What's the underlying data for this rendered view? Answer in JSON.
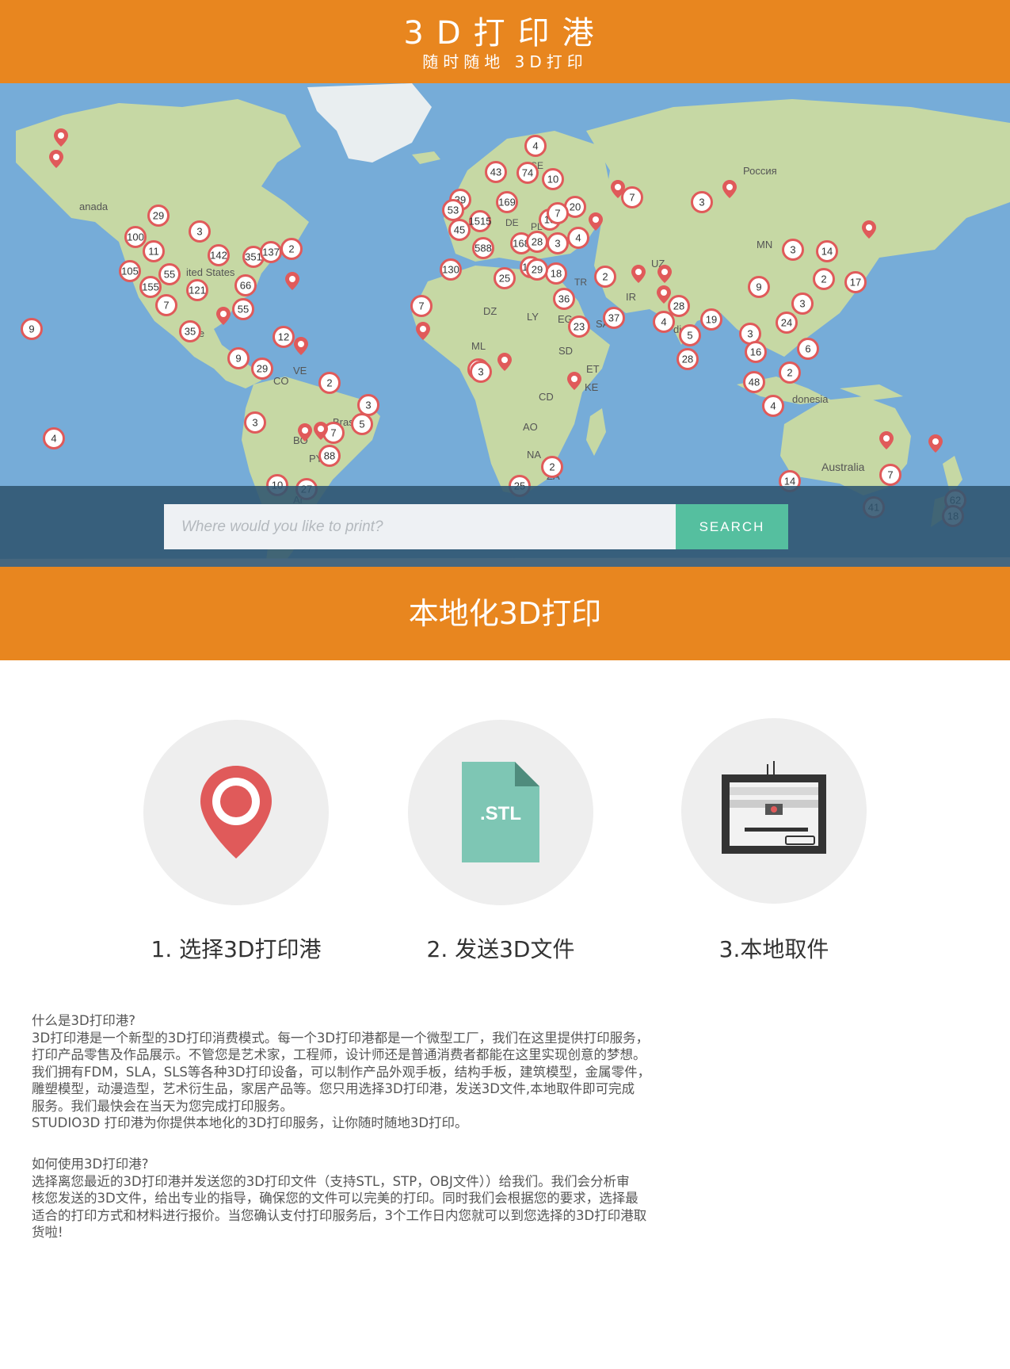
{
  "header": {
    "title": "3D打印港",
    "subtitle": "随时随地 3D打印"
  },
  "map": {
    "ocean_color": "#76acd8",
    "land_color": "#c6d8a4",
    "places": [
      "Россия",
      "anada",
      "ited States",
      "MN",
      "Australia",
      "donesia",
      "Brasil",
      "DZ",
      "LY",
      "EG",
      "ML",
      "SD",
      "CD",
      "AO",
      "NA",
      "ZA",
      "KE",
      "ET",
      "SA",
      "IR",
      "UZ",
      "VE",
      "CO",
      "BO",
      "PY",
      "Ar",
      "Me",
      "dia",
      "DE",
      "PL",
      "SE",
      "TR"
    ],
    "clusters": [
      "4",
      "43",
      "74",
      "10",
      "169",
      "20",
      "7",
      "3",
      "29",
      "39",
      "53",
      "1515",
      "45",
      "168",
      "28",
      "3",
      "4",
      "13",
      "588",
      "130",
      "25",
      "194",
      "18",
      "29",
      "100",
      "11",
      "3",
      "142",
      "351",
      "137",
      "2",
      "105",
      "55",
      "155",
      "121",
      "66",
      "7",
      "55",
      "35",
      "12",
      "9",
      "29",
      "2",
      "3",
      "5",
      "7",
      "88",
      "3",
      "10",
      "27",
      "7",
      "2",
      "14",
      "3",
      "2",
      "17",
      "9",
      "3",
      "24",
      "28",
      "19",
      "4",
      "5",
      "37",
      "23",
      "3",
      "16",
      "6",
      "48",
      "2",
      "4",
      "28",
      "36",
      "3",
      "2",
      "25",
      "14",
      "7",
      "41",
      "62",
      "18",
      "9",
      "4",
      "2",
      "7",
      "2"
    ]
  },
  "search": {
    "placeholder": "Where would you like to print?",
    "button_label": "SEARCH"
  },
  "section_title": "本地化3D打印",
  "steps": [
    {
      "label": "1. 选择3D打印港",
      "icon": "map-pin-icon"
    },
    {
      "label": "2. 发送3D文件",
      "icon": "stl-file-icon",
      "icon_text": ".STL"
    },
    {
      "label": "3.本地取件",
      "icon": "3d-printer-icon"
    }
  ],
  "about": {
    "heading": "什么是3D打印港?",
    "lines": [
      "3D打印港是一个新型的3D打印消费模式。每一个3D打印港都是一个微型工厂，我们在这里提供打印服务，",
      "打印产品零售及作品展示。不管您是艺术家，工程师，设计师还是普通消费者都能在这里实现创意的梦想。",
      "我们拥有FDM，SLA，SLS等各种3D打印设备，可以制作产品外观手板，结构手板，建筑模型，金属零件，",
      "雕塑模型，动漫造型，艺术衍生品，家居产品等。您只用选择3D打印港，发送3D文件,本地取件即可完成",
      "服务。我们最快会在当天为您完成打印服务。",
      "STUDIO3D 打印港为你提供本地化的3D打印服务，让你随时随地3D打印。"
    ]
  },
  "howto": {
    "heading": "如何使用3D打印港?",
    "lines": [
      "选择离您最近的3D打印港并发送您的3D打印文件（支持STL，STP，OBJ文件））给我们。我们会分析审",
      "核您发送的3D文件，给出专业的指导，确保您的文件可以完美的打印。同时我们会根据您的要求，选择最",
      "适合的打印方式和材料进行报价。当您确认支付打印服务后，3个工作日内您就可以到您选择的3D打印港取",
      "货啦!"
    ]
  },
  "colors": {
    "orange": "#e8861f",
    "search_button": "#55bf9f",
    "marker_red": "#e05a5a",
    "stl_teal": "#7ec6b4"
  }
}
